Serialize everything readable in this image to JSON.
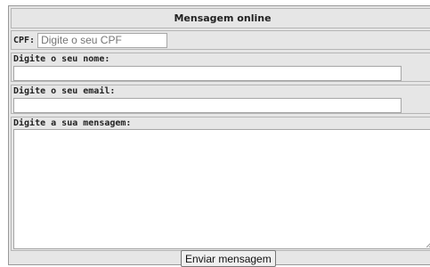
{
  "form": {
    "title": "Mensagem online",
    "cpf": {
      "label": "CPF:",
      "placeholder": "Digite o seu CPF",
      "value": ""
    },
    "name": {
      "label": "Digite o seu nome:",
      "value": ""
    },
    "email": {
      "label": "Digite o seu email:",
      "value": ""
    },
    "message": {
      "label": "Digite a sua mensagem:",
      "value": ""
    },
    "submit_label": "Enviar mensagem"
  },
  "colors": {
    "panel_background": "#e6e6e6",
    "field_background": "#ffffff",
    "border": "#a6a6a6"
  },
  "icons": {
    "resize_grip": "resize-grip-icon"
  }
}
